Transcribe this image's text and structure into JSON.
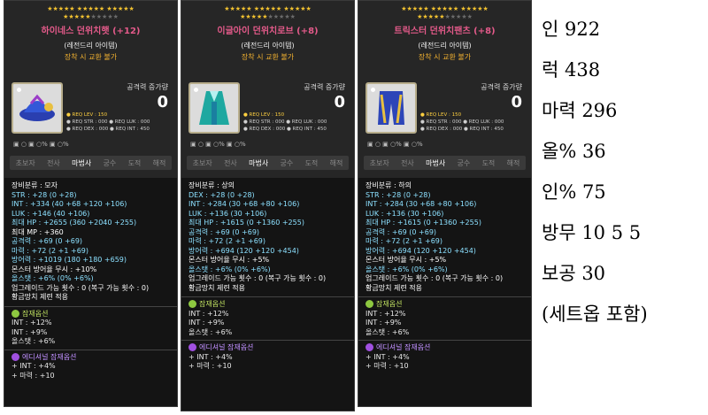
{
  "items": [
    {
      "stars": "★★★★★ ★★★★★ ★★★★★",
      "stars2": "★★★★★",
      "stars2dim": "★★★★★",
      "title": "하이네스 던위치햇 (+12)",
      "title_color": "#e45a8a",
      "grade": "(레전드리 아이템)",
      "trade": "장착 시 교환 불가",
      "atk_label": "공격력 증가량",
      "atk_value": "0",
      "req": [
        "● REQ LEV : 150",
        "● REQ STR : 000   ● REQ LUK : 000",
        "● REQ DEX : 000   ● REQ INT : 450"
      ],
      "jobs": [
        "초보자",
        "전사",
        "마법사",
        "궁수",
        "도적",
        "해적"
      ],
      "stats": [
        {
          "label": "장비분류 : 모자",
          "cls": "w"
        },
        {
          "label": "STR : +28 (0 +28)",
          "cls": "c"
        },
        {
          "label": "INT : +334 (40 +68 +120 +106)",
          "cls": "c"
        },
        {
          "label": "LUK : +146 (40 +106)",
          "cls": "c"
        },
        {
          "label": "최대 HP : +2655 (360 +2040 +255)",
          "cls": "c"
        },
        {
          "label": "최대 MP : +360",
          "cls": "w"
        },
        {
          "label": "공격력 : +69 (0 +69)",
          "cls": "c"
        },
        {
          "label": "마력 : +72 (2 +1 +69)",
          "cls": "c"
        },
        {
          "label": "방어력 : +1019 (180 +180 +659)",
          "cls": "c"
        },
        {
          "label": "몬스터 방어율 무시 : +10%",
          "cls": "w"
        },
        {
          "label": "올스탯 : +6% (0% +6%)",
          "cls": "c"
        },
        {
          "label": "업그레이드 가능 횟수 : 0 (복구 가능 횟수 : 0)",
          "cls": "w"
        },
        {
          "label": "황금망치 제련 적용",
          "cls": "w"
        }
      ],
      "pot_title": "잠재옵션",
      "pot": [
        "INT : +12%",
        "INT : +9%",
        "올스탯 : +6%"
      ],
      "add_title": "에디셔널 잠재옵션",
      "add": [
        "+ INT : +4%",
        "+ 마력 : +10"
      ]
    },
    {
      "stars": "★★★★★ ★★★★★ ★★★★★",
      "stars2": "★★★★★",
      "stars2dim": "★★★★★",
      "title": "이글아이 던위치로브 (+8)",
      "title_color": "#e45a8a",
      "grade": "(레전드리 아이템)",
      "trade": "장착 시 교환 불가",
      "atk_label": "공격력 증가량",
      "atk_value": "0",
      "req": [
        "● REQ LEV : 150",
        "● REQ STR : 000   ● REQ LUK : 000",
        "● REQ DEX : 000   ● REQ INT : 450"
      ],
      "jobs": [
        "초보자",
        "전사",
        "마법사",
        "궁수",
        "도적",
        "해적"
      ],
      "stats": [
        {
          "label": "장비분류 : 상의",
          "cls": "w"
        },
        {
          "label": "DEX : +28 (0 +28)",
          "cls": "c"
        },
        {
          "label": "INT : +284 (30 +68 +80 +106)",
          "cls": "c"
        },
        {
          "label": "LUK : +136 (30 +106)",
          "cls": "c"
        },
        {
          "label": "최대 HP : +1615 (0 +1360 +255)",
          "cls": "c"
        },
        {
          "label": "공격력 : +69 (0 +69)",
          "cls": "c"
        },
        {
          "label": "마력 : +72 (2 +1 +69)",
          "cls": "c"
        },
        {
          "label": "방어력 : +694 (120 +120 +454)",
          "cls": "c"
        },
        {
          "label": "몬스터 방어율 무시 : +5%",
          "cls": "w"
        },
        {
          "label": "올스탯 : +6% (0% +6%)",
          "cls": "c"
        },
        {
          "label": "업그레이드 가능 횟수 : 0 (복구 가능 횟수 : 0)",
          "cls": "w"
        },
        {
          "label": "황금망치 제련 적용",
          "cls": "w"
        }
      ],
      "pot_title": "잠재옵션",
      "pot": [
        "INT : +12%",
        "INT : +9%",
        "올스탯 : +6%"
      ],
      "add_title": "에디셔널 잠재옵션",
      "add": [
        "+ INT : +4%",
        "+ 마력 : +10"
      ]
    },
    {
      "stars": "★★★★★ ★★★★★ ★★★★★",
      "stars2": "★★★★★",
      "stars2dim": "★★★★★",
      "title": "트릭스터 던위치팬츠 (+8)",
      "title_color": "#e45a8a",
      "grade": "(레전드리 아이템)",
      "trade": "장착 시 교환 불가",
      "atk_label": "공격력 증가량",
      "atk_value": "0",
      "req": [
        "● REQ LEV : 150",
        "● REQ STR : 000   ● REQ LUK : 000",
        "● REQ DEX : 000   ● REQ INT : 450"
      ],
      "jobs": [
        "초보자",
        "전사",
        "마법사",
        "궁수",
        "도적",
        "해적"
      ],
      "stats": [
        {
          "label": "장비분류 : 하의",
          "cls": "w"
        },
        {
          "label": "STR : +28 (0 +28)",
          "cls": "c"
        },
        {
          "label": "INT : +284 (30 +68 +80 +106)",
          "cls": "c"
        },
        {
          "label": "LUK : +136 (30 +106)",
          "cls": "c"
        },
        {
          "label": "최대 HP : +1615 (0 +1360 +255)",
          "cls": "c"
        },
        {
          "label": "공격력 : +69 (0 +69)",
          "cls": "c"
        },
        {
          "label": "마력 : +72 (2 +1 +69)",
          "cls": "c"
        },
        {
          "label": "방어력 : +694 (120 +120 +454)",
          "cls": "c"
        },
        {
          "label": "몬스터 방어율 무시 : +5%",
          "cls": "w"
        },
        {
          "label": "올스탯 : +6% (0% +6%)",
          "cls": "c"
        },
        {
          "label": "업그레이드 가능 횟수 : 0 (복구 가능 횟수 : 0)",
          "cls": "w"
        },
        {
          "label": "황금망치 제련 적용",
          "cls": "w"
        }
      ],
      "pot_title": "잠재옵션",
      "pot": [
        "INT : +12%",
        "INT : +9%",
        "올스탯 : +6%"
      ],
      "add_title": "에디셔널 잠재옵션",
      "add": [
        "+ INT : +4%",
        "+ 마력 : +10"
      ]
    }
  ],
  "summary": [
    "인 922",
    "럭 438",
    "마력 296",
    "올% 36",
    "인% 75",
    "방무 10 5 5",
    "보공 30",
    "(세트옵 포함)"
  ]
}
